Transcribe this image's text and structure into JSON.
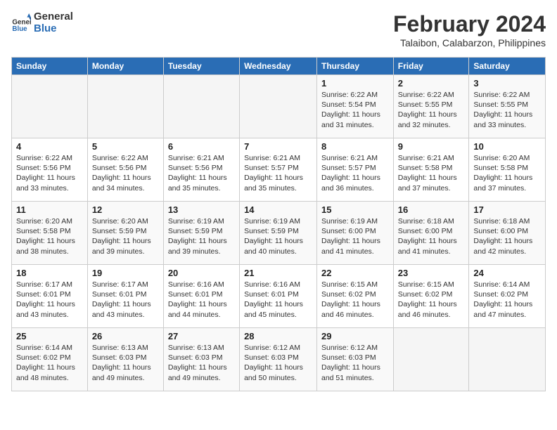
{
  "header": {
    "logo_line1": "General",
    "logo_line2": "Blue",
    "month_title": "February 2024",
    "location": "Talaibon, Calabarzon, Philippines"
  },
  "days_of_week": [
    "Sunday",
    "Monday",
    "Tuesday",
    "Wednesday",
    "Thursday",
    "Friday",
    "Saturday"
  ],
  "weeks": [
    [
      {
        "day": "",
        "info": ""
      },
      {
        "day": "",
        "info": ""
      },
      {
        "day": "",
        "info": ""
      },
      {
        "day": "",
        "info": ""
      },
      {
        "day": "1",
        "info": "Sunrise: 6:22 AM\nSunset: 5:54 PM\nDaylight: 11 hours and 31 minutes."
      },
      {
        "day": "2",
        "info": "Sunrise: 6:22 AM\nSunset: 5:55 PM\nDaylight: 11 hours and 32 minutes."
      },
      {
        "day": "3",
        "info": "Sunrise: 6:22 AM\nSunset: 5:55 PM\nDaylight: 11 hours and 33 minutes."
      }
    ],
    [
      {
        "day": "4",
        "info": "Sunrise: 6:22 AM\nSunset: 5:56 PM\nDaylight: 11 hours and 33 minutes."
      },
      {
        "day": "5",
        "info": "Sunrise: 6:22 AM\nSunset: 5:56 PM\nDaylight: 11 hours and 34 minutes."
      },
      {
        "day": "6",
        "info": "Sunrise: 6:21 AM\nSunset: 5:56 PM\nDaylight: 11 hours and 35 minutes."
      },
      {
        "day": "7",
        "info": "Sunrise: 6:21 AM\nSunset: 5:57 PM\nDaylight: 11 hours and 35 minutes."
      },
      {
        "day": "8",
        "info": "Sunrise: 6:21 AM\nSunset: 5:57 PM\nDaylight: 11 hours and 36 minutes."
      },
      {
        "day": "9",
        "info": "Sunrise: 6:21 AM\nSunset: 5:58 PM\nDaylight: 11 hours and 37 minutes."
      },
      {
        "day": "10",
        "info": "Sunrise: 6:20 AM\nSunset: 5:58 PM\nDaylight: 11 hours and 37 minutes."
      }
    ],
    [
      {
        "day": "11",
        "info": "Sunrise: 6:20 AM\nSunset: 5:58 PM\nDaylight: 11 hours and 38 minutes."
      },
      {
        "day": "12",
        "info": "Sunrise: 6:20 AM\nSunset: 5:59 PM\nDaylight: 11 hours and 39 minutes."
      },
      {
        "day": "13",
        "info": "Sunrise: 6:19 AM\nSunset: 5:59 PM\nDaylight: 11 hours and 39 minutes."
      },
      {
        "day": "14",
        "info": "Sunrise: 6:19 AM\nSunset: 5:59 PM\nDaylight: 11 hours and 40 minutes."
      },
      {
        "day": "15",
        "info": "Sunrise: 6:19 AM\nSunset: 6:00 PM\nDaylight: 11 hours and 41 minutes."
      },
      {
        "day": "16",
        "info": "Sunrise: 6:18 AM\nSunset: 6:00 PM\nDaylight: 11 hours and 41 minutes."
      },
      {
        "day": "17",
        "info": "Sunrise: 6:18 AM\nSunset: 6:00 PM\nDaylight: 11 hours and 42 minutes."
      }
    ],
    [
      {
        "day": "18",
        "info": "Sunrise: 6:17 AM\nSunset: 6:01 PM\nDaylight: 11 hours and 43 minutes."
      },
      {
        "day": "19",
        "info": "Sunrise: 6:17 AM\nSunset: 6:01 PM\nDaylight: 11 hours and 43 minutes."
      },
      {
        "day": "20",
        "info": "Sunrise: 6:16 AM\nSunset: 6:01 PM\nDaylight: 11 hours and 44 minutes."
      },
      {
        "day": "21",
        "info": "Sunrise: 6:16 AM\nSunset: 6:01 PM\nDaylight: 11 hours and 45 minutes."
      },
      {
        "day": "22",
        "info": "Sunrise: 6:15 AM\nSunset: 6:02 PM\nDaylight: 11 hours and 46 minutes."
      },
      {
        "day": "23",
        "info": "Sunrise: 6:15 AM\nSunset: 6:02 PM\nDaylight: 11 hours and 46 minutes."
      },
      {
        "day": "24",
        "info": "Sunrise: 6:14 AM\nSunset: 6:02 PM\nDaylight: 11 hours and 47 minutes."
      }
    ],
    [
      {
        "day": "25",
        "info": "Sunrise: 6:14 AM\nSunset: 6:02 PM\nDaylight: 11 hours and 48 minutes."
      },
      {
        "day": "26",
        "info": "Sunrise: 6:13 AM\nSunset: 6:03 PM\nDaylight: 11 hours and 49 minutes."
      },
      {
        "day": "27",
        "info": "Sunrise: 6:13 AM\nSunset: 6:03 PM\nDaylight: 11 hours and 49 minutes."
      },
      {
        "day": "28",
        "info": "Sunrise: 6:12 AM\nSunset: 6:03 PM\nDaylight: 11 hours and 50 minutes."
      },
      {
        "day": "29",
        "info": "Sunrise: 6:12 AM\nSunset: 6:03 PM\nDaylight: 11 hours and 51 minutes."
      },
      {
        "day": "",
        "info": ""
      },
      {
        "day": "",
        "info": ""
      }
    ]
  ]
}
